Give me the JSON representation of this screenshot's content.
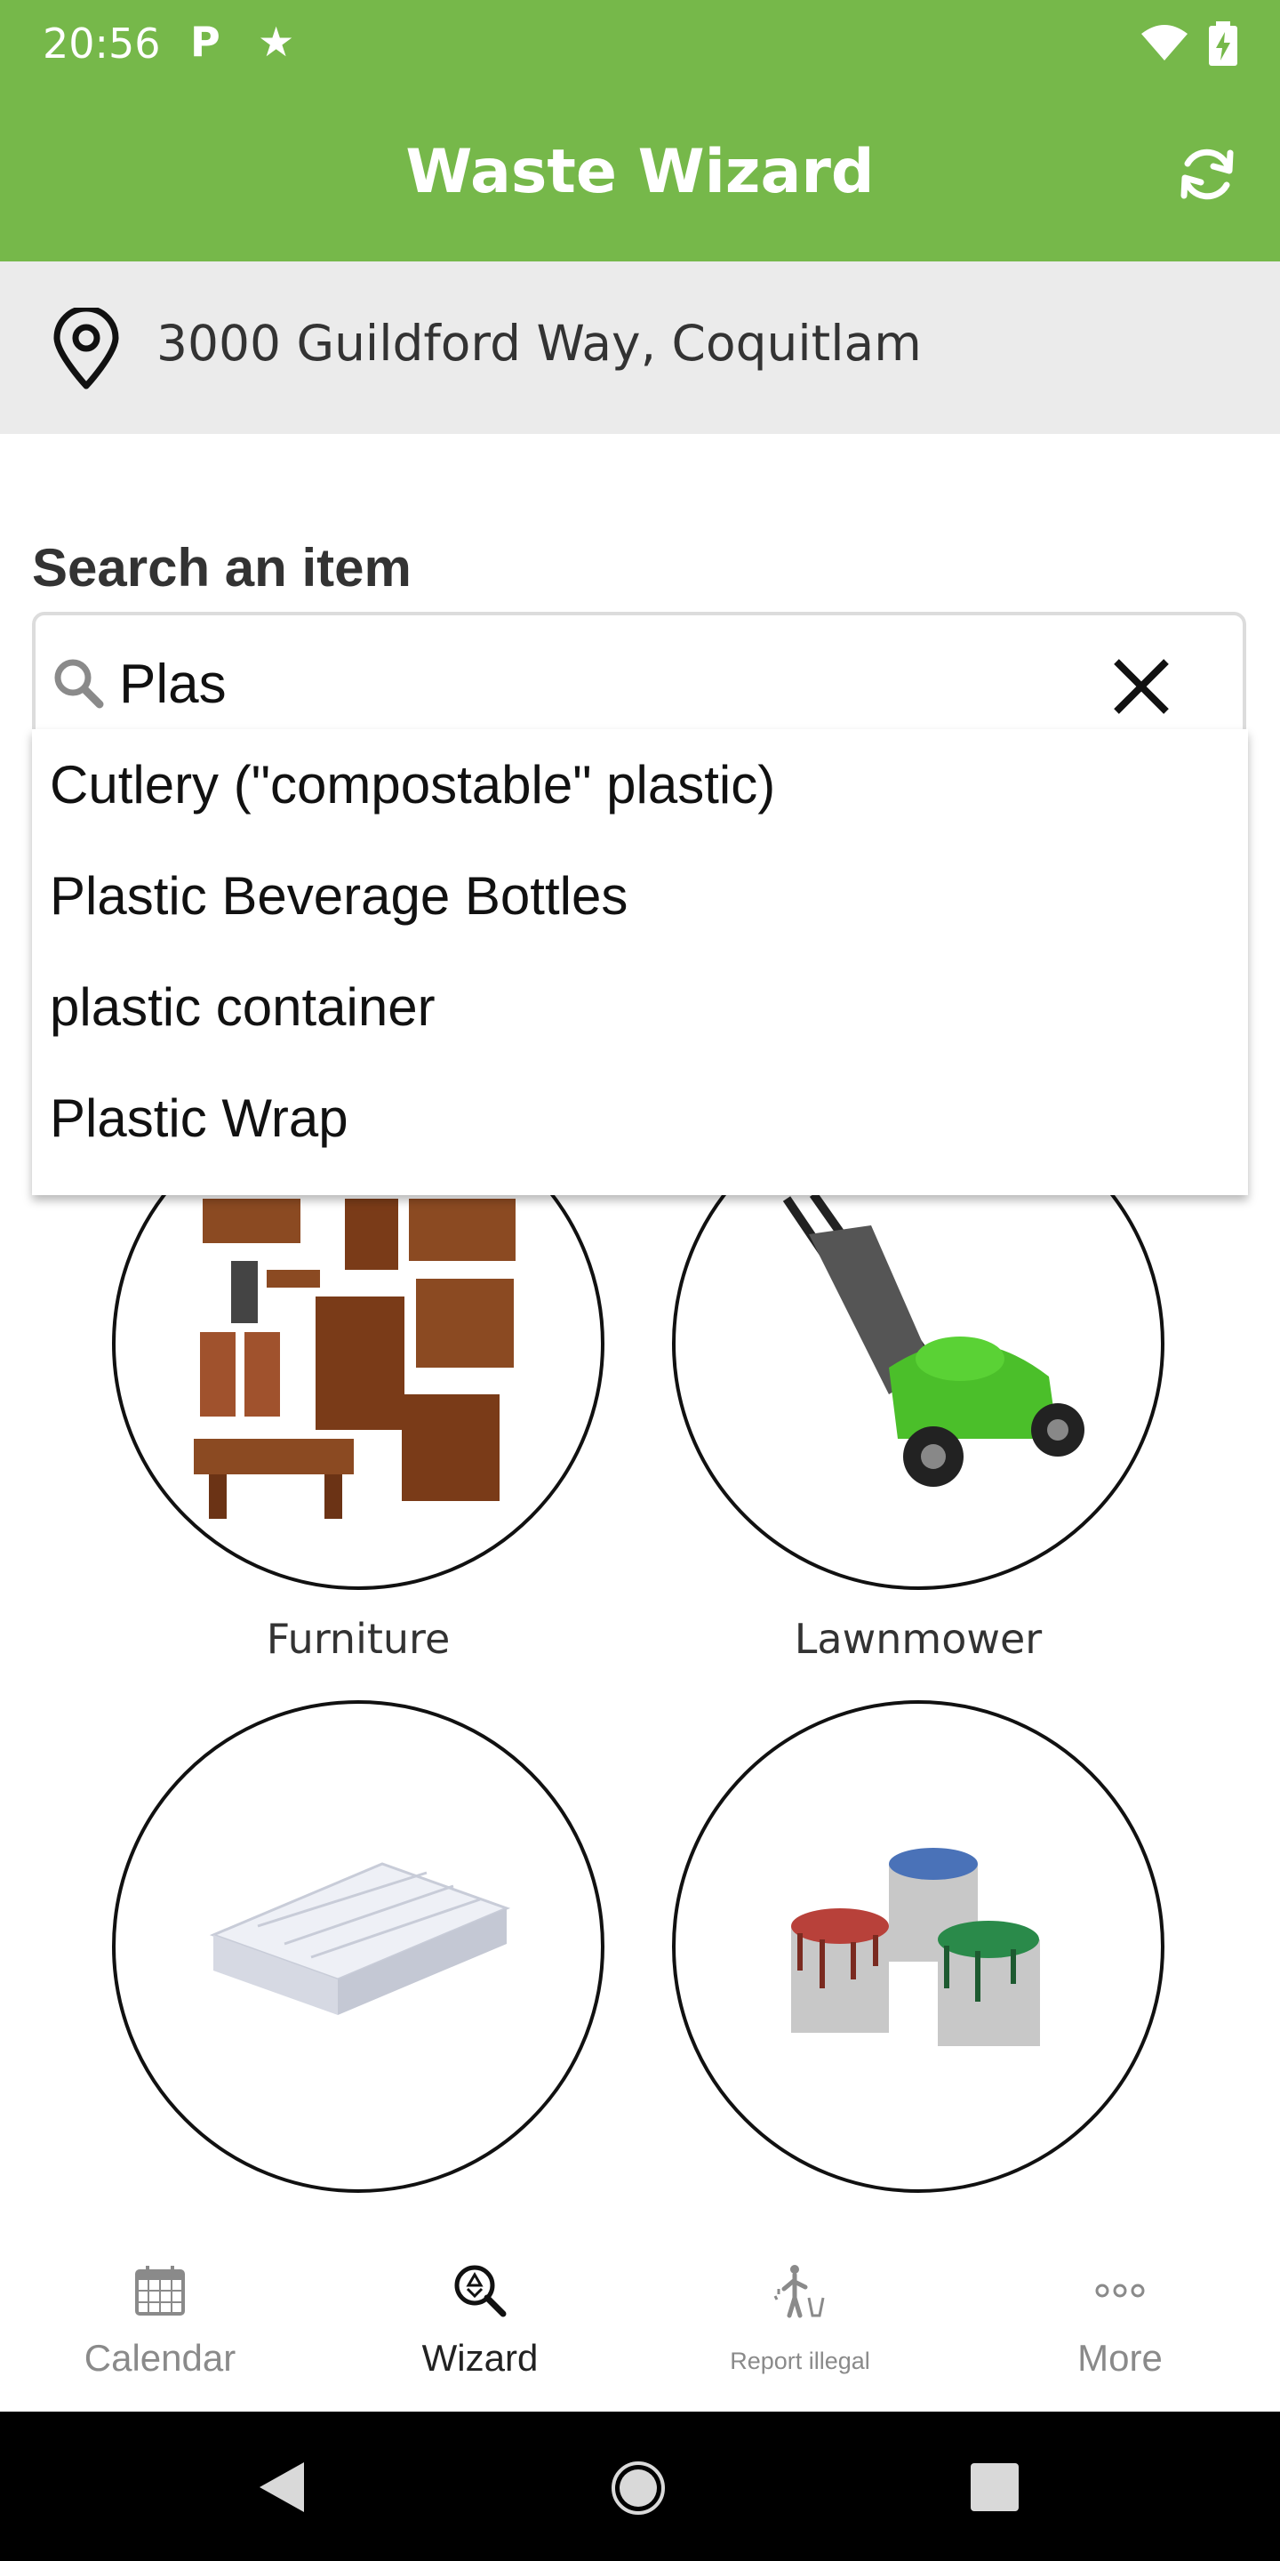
{
  "status_bar": {
    "time": "20:56",
    "p_icon": "P"
  },
  "header": {
    "title": "Waste Wizard",
    "refresh_icon": "refresh-icon",
    "color": "#76b84a"
  },
  "location": {
    "address": "3000 Guildford Way, Coquitlam",
    "icon": "location-pin-icon"
  },
  "search": {
    "heading": "Search an item",
    "value": "Plas",
    "suggestions": [
      "Cutlery (\"compostable\" plastic)",
      "Plastic Beverage Bottles",
      "plastic container",
      "Plastic Wrap"
    ]
  },
  "categories": [
    {
      "label": "Furniture"
    },
    {
      "label": "Lawnmower"
    },
    {
      "label": ""
    },
    {
      "label": ""
    }
  ],
  "bottom_nav": [
    {
      "label": "Calendar",
      "icon": "calendar-icon"
    },
    {
      "label": "Wizard",
      "icon": "wizard-icon",
      "active": true
    },
    {
      "label": "Report illegal",
      "icon": "report-illegal-icon"
    },
    {
      "label": "More",
      "icon": "more-icon"
    }
  ]
}
